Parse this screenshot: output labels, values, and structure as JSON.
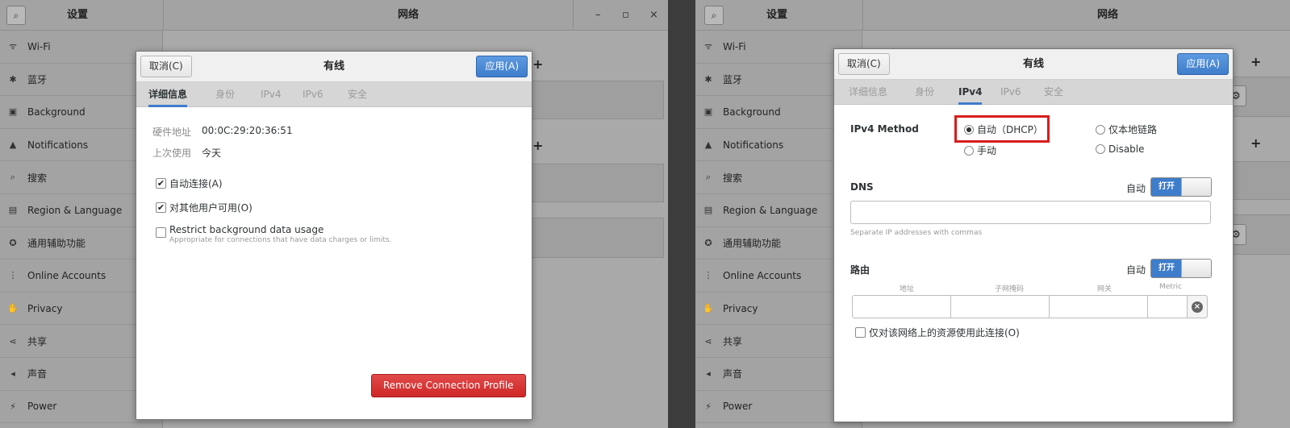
{
  "left": {
    "settings_title": "设置",
    "network_title": "网络",
    "window_controls": {
      "minimize": "–",
      "maximize": "▫",
      "close": "×"
    },
    "sidebar": [
      {
        "label": "Wi-Fi",
        "icon": "wifi-icon",
        "glyph": "ᯤ"
      },
      {
        "label": "蓝牙",
        "icon": "bluetooth-icon",
        "glyph": "✱"
      },
      {
        "label": "Background",
        "icon": "background-icon",
        "glyph": "▣"
      },
      {
        "label": "Notifications",
        "icon": "bell-icon",
        "glyph": "▲"
      },
      {
        "label": "搜索",
        "icon": "search-icon",
        "glyph": "⌕"
      },
      {
        "label": "Region & Language",
        "icon": "region-icon",
        "glyph": "▤"
      },
      {
        "label": "通用辅助功能",
        "icon": "accessibility-icon",
        "glyph": "✪"
      },
      {
        "label": "Online Accounts",
        "icon": "online-accounts-icon",
        "glyph": "⋮"
      },
      {
        "label": "Privacy",
        "icon": "privacy-icon",
        "glyph": "✋"
      },
      {
        "label": "共享",
        "icon": "share-icon",
        "glyph": "⋖"
      },
      {
        "label": "声音",
        "icon": "sound-icon",
        "glyph": "◂"
      },
      {
        "label": "Power",
        "icon": "power-icon",
        "glyph": "⚡"
      }
    ],
    "dialog": {
      "cancel": "取消(C)",
      "title": "有线",
      "apply": "应用(A)",
      "tabs": [
        "详细信息",
        "身份",
        "IPv4",
        "IPv6",
        "安全"
      ],
      "active_tab": "详细信息",
      "hw_label": "硬件地址",
      "hw_value": "00:0C:29:20:36:51",
      "last_used_label": "上次使用",
      "last_used_value": "今天",
      "auto_connect": "自动连接(A)",
      "auto_connect_checked": true,
      "all_users": "对其他用户可用(O)",
      "all_users_checked": true,
      "restrict": "Restrict background data usage",
      "restrict_checked": false,
      "restrict_hint": "Appropriate for connections that have data charges or limits.",
      "remove": "Remove Connection Profile"
    }
  },
  "right": {
    "settings_title": "设置",
    "network_title": "网络",
    "dialog": {
      "cancel": "取消(C)",
      "title": "有线",
      "apply": "应用(A)",
      "tabs": [
        "详细信息",
        "身份",
        "IPv4",
        "IPv6",
        "安全"
      ],
      "active_tab": "IPv4",
      "method_label": "IPv4 Method",
      "method_options": [
        "自动（DHCP）",
        "仅本地链路",
        "手动",
        "Disable"
      ],
      "method_selected": "自动（DHCP）",
      "dns_label": "DNS",
      "dns_auto": "自动",
      "dns_switch": "打开",
      "dns_value": "",
      "dns_hint": "Separate IP addresses with commas",
      "routes_label": "路由",
      "routes_auto": "自动",
      "routes_switch": "打开",
      "route_columns": [
        "地址",
        "子网掩码",
        "网关",
        "Metric"
      ],
      "only_local": "仅对该网络上的资源使用此连接(O)",
      "only_local_checked": false
    }
  },
  "colors": {
    "accent": "#3e7dcb",
    "destructive": "#cf2727",
    "highlight": "#d81d1d"
  }
}
